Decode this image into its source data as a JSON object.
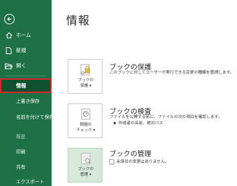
{
  "sidebar": {
    "items": [
      {
        "label": "ホーム",
        "icon": "home-icon"
      },
      {
        "label": "新規",
        "icon": "new-document-icon"
      },
      {
        "label": "開く",
        "icon": "open-folder-icon"
      }
    ],
    "active_item": "情報",
    "lower_items": {
      "save": "上書き保存",
      "save_as": "名前を付けて保存",
      "history": "履歴",
      "print": "印刷",
      "share": "共有",
      "export": "エクスポート"
    }
  },
  "main": {
    "title": "情報",
    "cards": [
      {
        "button_label_1": "ブックの",
        "button_label_2": "保護",
        "title": "ブックの保護",
        "description": "このブックに対してユーザーが実行できる変更の種類を管理します。"
      },
      {
        "button_label_1": "問題の",
        "button_label_2": "チェック",
        "title": "ブックの検査",
        "description": "ファイルを公開する前に、ファイルの次の項目を確認します。",
        "bullet": "作成者の名前、絶対パス"
      },
      {
        "button_label_1": "ブックの",
        "button_label_2": "管理",
        "title": "ブックの管理",
        "description": "未保存の変更はありません。"
      }
    ]
  },
  "colors": {
    "sidebar_bg": "#1e7145",
    "active_bg": "#10522f",
    "active_border": "#d9262b",
    "manage_button_bg": "#d7ead9"
  }
}
